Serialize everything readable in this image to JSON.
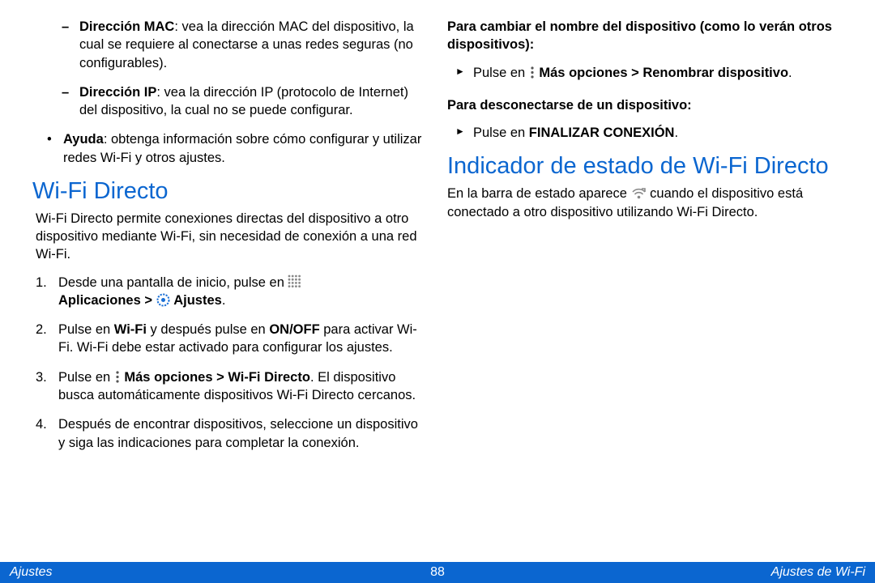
{
  "col1": {
    "mac": {
      "title": "Dirección MAC",
      "body": ": vea la dirección MAC del dispositivo, la cual se requiere al conectarse a unas redes seguras (no configurables)."
    },
    "ip": {
      "title": "Dirección IP",
      "body": ": vea la dirección IP (protocolo de Internet) del dispositivo, la cual no se puede configurar."
    },
    "ayuda": {
      "title": "Ayuda",
      "body": ": obtenga información sobre cómo configurar y utilizar redes Wi-Fi y otros ajustes."
    },
    "heading": "Wi-Fi Directo",
    "intro": "Wi-Fi Directo permite conexiones directas del dispositivo a otro dispositivo mediante Wi-Fi, sin necesidad de conexión a una red Wi-Fi.",
    "step1": {
      "n": "1.",
      "a": "Desde una pantalla de inicio, pulse en ",
      "b": "Aplicaciones",
      "c": " > ",
      "d": "Ajustes",
      "e": "."
    },
    "step2": {
      "n": "2.",
      "a": "Pulse en ",
      "b": "Wi-Fi",
      "c": " y después pulse en ",
      "d": "ON/OFF",
      "e": " para activar Wi-Fi. Wi-Fi debe estar activado para configurar los ajustes."
    },
    "step3": {
      "n": "3.",
      "a": "Pulse en ",
      "b": "Más opciones",
      "c": " > ",
      "d": "Wi-Fi Directo",
      "e": ". El dispositivo busca automáticamente dispositivos Wi-Fi Directo cercanos."
    },
    "step4": {
      "n": "4.",
      "a": "Después de encontrar dispositivos, seleccione un dispositivo y siga las indicaciones para completar la conexión."
    }
  },
  "col2": {
    "rename_heading": "Para cambiar el nombre del dispositivo (como lo verán otros dispositivos):",
    "rename": {
      "a": "Pulse en ",
      "b": "Más opciones",
      "c": " > ",
      "d": "Renombrar dispositivo",
      "e": "."
    },
    "disconnect_heading": "Para desconectarse de un dispositivo:",
    "disconnect": {
      "a": "Pulse en ",
      "b": "FINALIZAR CONEXIÓN",
      "c": "."
    },
    "heading": "Indicador de estado de Wi-Fi Directo",
    "intro_a": "En la barra de estado aparece ",
    "intro_b": " cuando el dispositivo está conectado a otro dispositivo utilizando Wi-Fi Directo."
  },
  "footer": {
    "left": "Ajustes",
    "center": "88",
    "right": "Ajustes de Wi-Fi"
  }
}
